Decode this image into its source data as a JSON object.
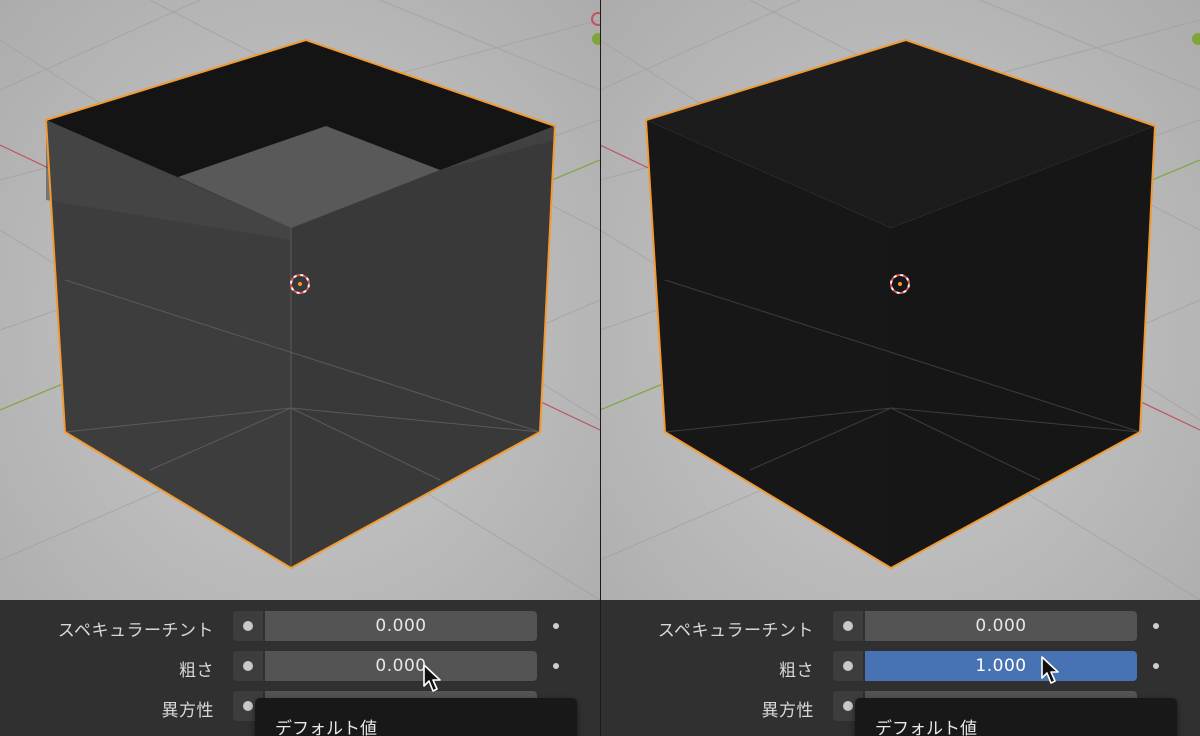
{
  "colors": {
    "selection_outline": "#f29a32",
    "active_field": "#4772b3",
    "x_axis": "#c0535f",
    "y_axis": "#7ea53a"
  },
  "left_panel": {
    "rows": [
      {
        "label": "スペキュラーチント",
        "value": "0.000"
      },
      {
        "label": "粗さ",
        "value": "0.000"
      },
      {
        "label": "異方性",
        "value": ""
      }
    ],
    "popup_item": "デフォルト値"
  },
  "right_panel": {
    "rows": [
      {
        "label": "スペキュラーチント",
        "value": "0.000"
      },
      {
        "label": "粗さ",
        "value": "1.000"
      },
      {
        "label": "異方性",
        "value": ""
      }
    ],
    "popup_item": "デフォルト値"
  }
}
